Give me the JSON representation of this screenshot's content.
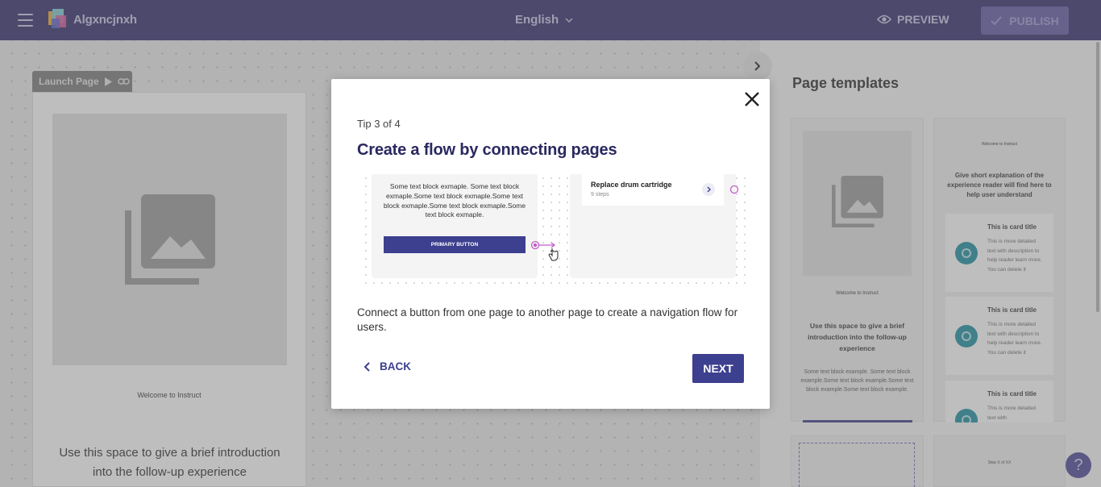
{
  "header": {
    "brand": "Algxncjnxh",
    "language": "English",
    "preview_label": "PREVIEW",
    "publish_label": "PUBLISH"
  },
  "canvas": {
    "launch_tab_label": "Launch Page",
    "page": {
      "welcome": "Welcome to Instruct",
      "intro": "Use this space to give a brief introduction into the follow-up experience"
    }
  },
  "templates_panel": {
    "title": "Page templates",
    "template1": {
      "welcome": "Welcome to Instruct",
      "heading": "Use this space to give a brief introduction into the follow-up experience",
      "body": "Some text block example. Some text block example.Some text block example.Some text block example.Some text block example."
    },
    "template2": {
      "welcome": "Welcome to Instruct",
      "heading": "Give short explanation of the experience reader will find here to help user understand",
      "cards": [
        {
          "title": "This is card title",
          "text": "This is more detailed text with description to help reader learn more. You can delete it"
        },
        {
          "title": "This is card title",
          "text": "This is more detailed text with description to help reader learn more. You can delete it"
        },
        {
          "title": "This is card title",
          "text": "This is more detailed text with"
        }
      ]
    },
    "template4": {
      "step": "Step X of XX"
    }
  },
  "help_label": "?",
  "modal": {
    "tip": "Tip 3 of 4",
    "title": "Create a flow by connecting pages",
    "illustration": {
      "page_a_text": "Some text block exmaple. Some text block exmaple.Some text block exmaple.Some text block exmaple.Some text block exmaple.Some text block exmaple.",
      "primary_button": "PRIMARY BUTTON",
      "item_title": "Replace drum cartridge",
      "item_subtitle": "9 steps"
    },
    "description": "Connect a button from one page to another page to create a navigation flow for users.",
    "back_label": "BACK",
    "next_label": "NEXT"
  },
  "colors": {
    "topbar": "#302a6b",
    "accent": "#3d3f8f",
    "connector": "#c45cc9",
    "card_icon": "#1a8fa0"
  }
}
